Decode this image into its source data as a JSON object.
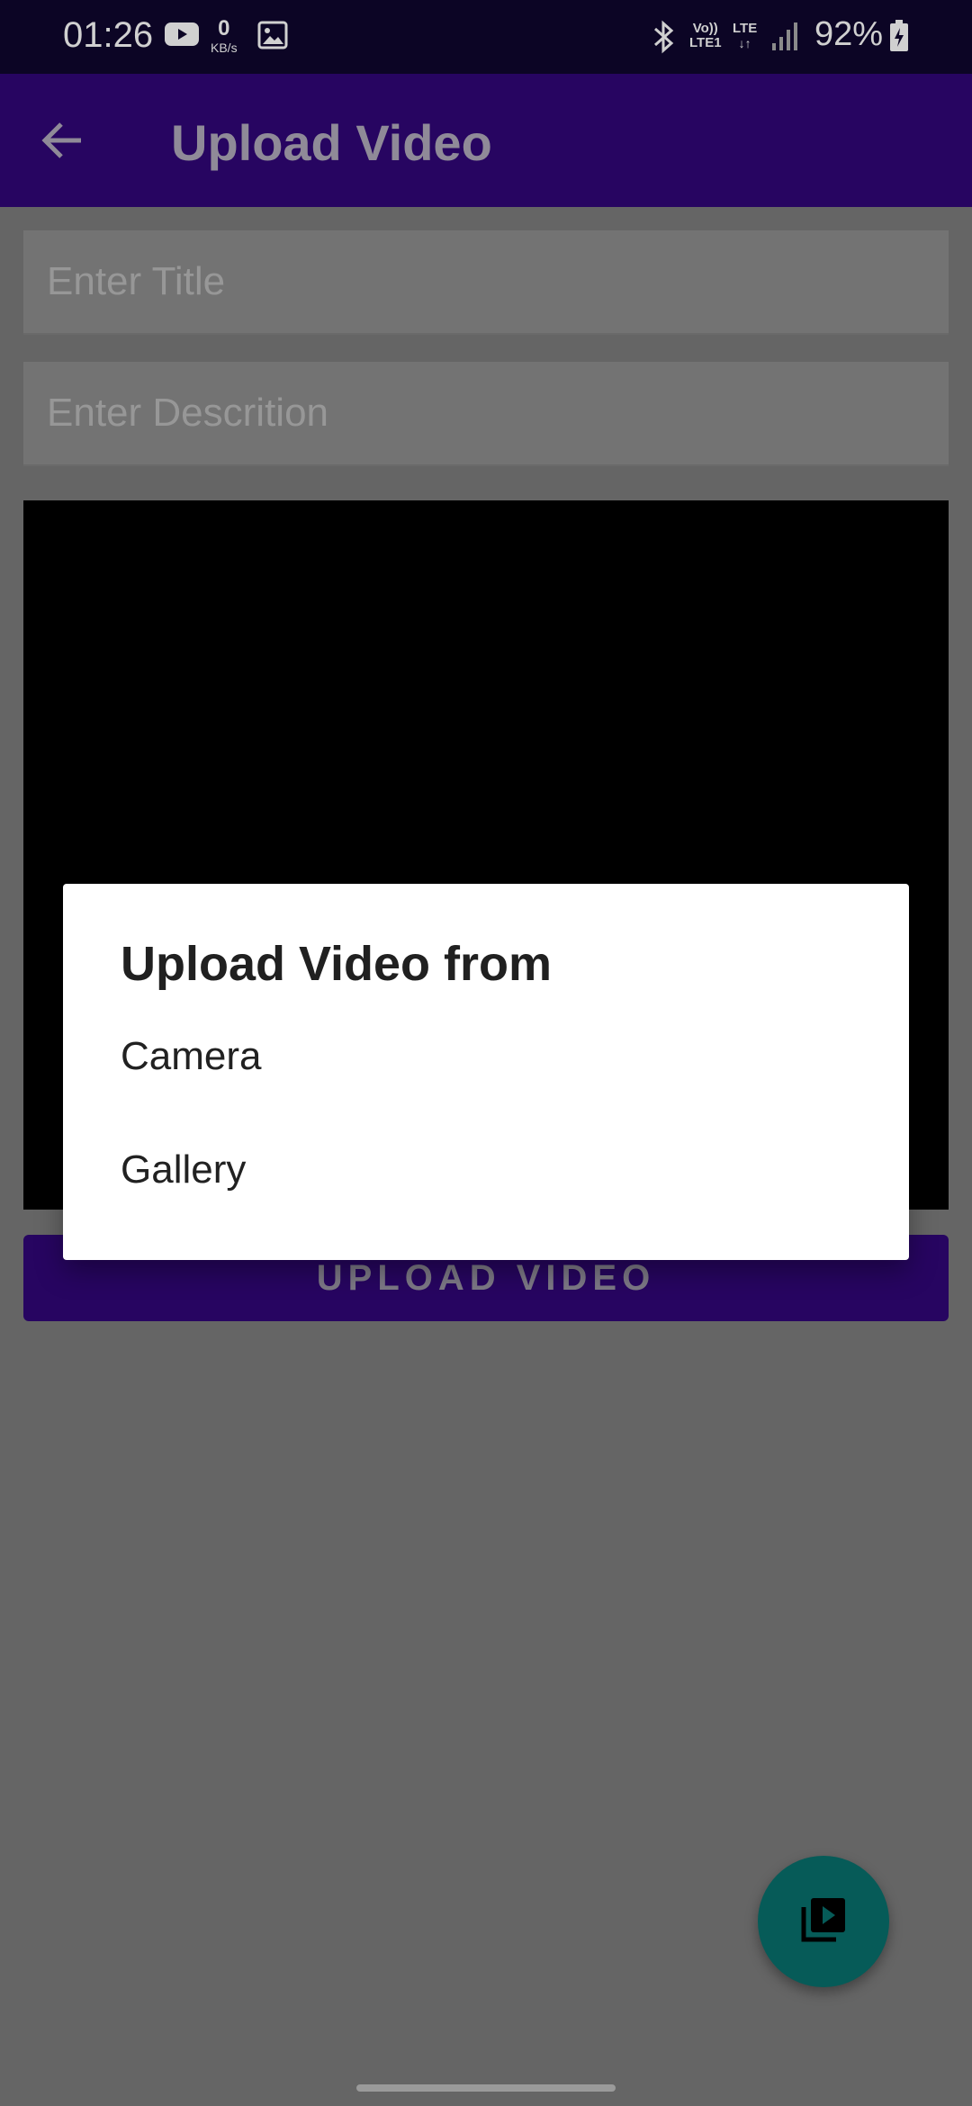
{
  "status_bar": {
    "time": "01:26",
    "data_rate": "0",
    "data_rate_unit": "KB/s",
    "volte_top": "Vo))",
    "volte_bottom": "LTE1",
    "lte_label": "LTE",
    "battery": "92%",
    "icons": [
      "youtube-icon",
      "image-icon",
      "bluetooth-icon",
      "signal-icon",
      "battery-charging-icon"
    ]
  },
  "app_bar": {
    "title": "Upload Video",
    "back_icon": "arrow-back-icon"
  },
  "form": {
    "title_placeholder": "Enter Title",
    "description_placeholder": "Enter Descrition",
    "upload_button_label": "UPLOAD VIDEO"
  },
  "fab": {
    "icon": "video-library-icon"
  },
  "dialog": {
    "title": "Upload Video from",
    "options": [
      "Camera",
      "Gallery"
    ]
  },
  "colors": {
    "status_bar": "#0c0525",
    "app_bar": "#270561",
    "scrim_background": "#656565",
    "fab": "#065b58",
    "dialog": "#ffffff"
  }
}
